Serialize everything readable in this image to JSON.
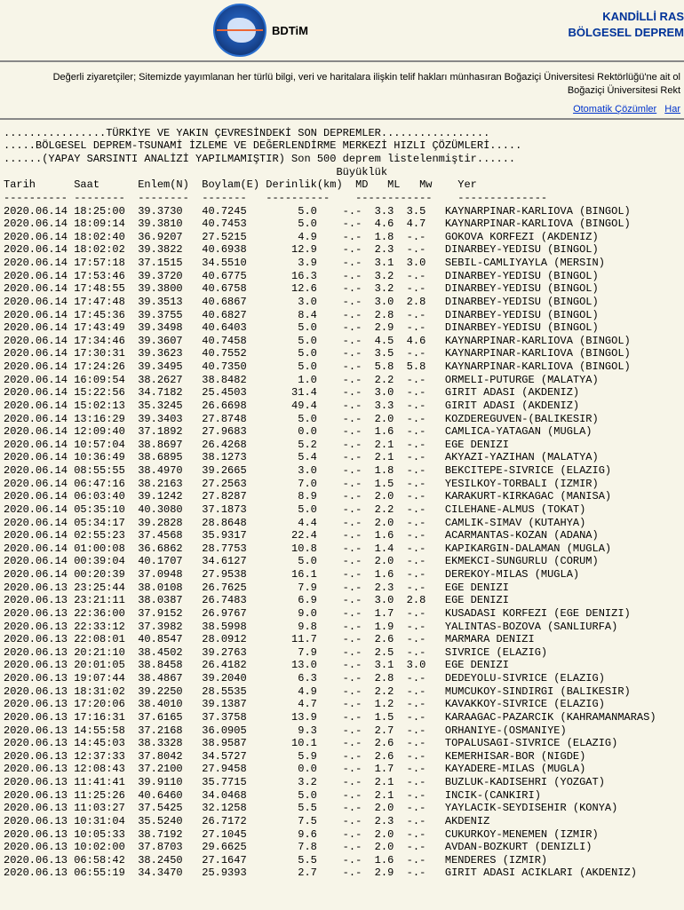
{
  "brand": "BDTiM",
  "title_right_1": "KANDİLLİ RAS",
  "title_right_2": "BÖLGESEL DEPREM",
  "notice_1": "Değerli ziyaretçiler; Sitemizde yayımlanan her türlü bilgi, veri ve haritalara ilişkin telif hakları münhasıran Boğaziçi Üniversitesi Rektörlüğü'ne ait ol",
  "notice_2": "Boğaziçi Üniversitesi Rekt",
  "link_1": "Otomatik Çözümler",
  "link_2": "Har",
  "intro": [
    "................TÜRKİYE VE YAKIN ÇEVRESİNDEKİ SON DEPREMLER.................",
    ".....BÖLGESEL DEPREM-TSUNAMİ İZLEME VE DEĞERLENDİRME MERKEZİ HIZLI ÇÖZÜMLERİ.....",
    "......(YAPAY SARSINTI ANALİZİ YAPILMAMIŞTIR) Son 500 deprem listelenmiştir......"
  ],
  "col_super": "                                                    Büyüklük",
  "col_header": "Tarih      Saat      Enlem(N)  Boylam(E) Derinlik(km)  MD   ML   Mw    Yer",
  "col_sep": "---------- --------  --------  -------   ----------    ------------    --------------",
  "rows": [
    {
      "d": "2020.06.14",
      "t": "18:25:00",
      "lat": "39.3730",
      "lon": "40.7245",
      "dep": "5.0",
      "md": "-.-",
      "ml": "3.3",
      "mw": "3.5",
      "loc": "KAYNARPINAR-KARLIOVA (BINGOL)"
    },
    {
      "d": "2020.06.14",
      "t": "18:09:14",
      "lat": "39.3810",
      "lon": "40.7453",
      "dep": "5.0",
      "md": "-.-",
      "ml": "4.6",
      "mw": "4.7",
      "loc": "KAYNARPINAR-KARLIOVA (BINGOL)"
    },
    {
      "d": "2020.06.14",
      "t": "18:02:40",
      "lat": "36.9207",
      "lon": "27.5215",
      "dep": "4.9",
      "md": "-.-",
      "ml": "1.8",
      "mw": "-.-",
      "loc": "GOKOVA KORFEZI (AKDENIZ)"
    },
    {
      "d": "2020.06.14",
      "t": "18:02:02",
      "lat": "39.3822",
      "lon": "40.6938",
      "dep": "12.9",
      "md": "-.-",
      "ml": "2.3",
      "mw": "-.-",
      "loc": "DINARBEY-YEDISU (BINGOL)"
    },
    {
      "d": "2020.06.14",
      "t": "17:57:18",
      "lat": "37.1515",
      "lon": "34.5510",
      "dep": "3.9",
      "md": "-.-",
      "ml": "3.1",
      "mw": "3.0",
      "loc": "SEBIL-CAMLIYAYLA (MERSIN)"
    },
    {
      "d": "2020.06.14",
      "t": "17:53:46",
      "lat": "39.3720",
      "lon": "40.6775",
      "dep": "16.3",
      "md": "-.-",
      "ml": "3.2",
      "mw": "-.-",
      "loc": "DINARBEY-YEDISU (BINGOL)"
    },
    {
      "d": "2020.06.14",
      "t": "17:48:55",
      "lat": "39.3800",
      "lon": "40.6758",
      "dep": "12.6",
      "md": "-.-",
      "ml": "3.2",
      "mw": "-.-",
      "loc": "DINARBEY-YEDISU (BINGOL)"
    },
    {
      "d": "2020.06.14",
      "t": "17:47:48",
      "lat": "39.3513",
      "lon": "40.6867",
      "dep": "3.0",
      "md": "-.-",
      "ml": "3.0",
      "mw": "2.8",
      "loc": "DINARBEY-YEDISU (BINGOL)"
    },
    {
      "d": "2020.06.14",
      "t": "17:45:36",
      "lat": "39.3755",
      "lon": "40.6827",
      "dep": "8.4",
      "md": "-.-",
      "ml": "2.8",
      "mw": "-.-",
      "loc": "DINARBEY-YEDISU (BINGOL)"
    },
    {
      "d": "2020.06.14",
      "t": "17:43:49",
      "lat": "39.3498",
      "lon": "40.6403",
      "dep": "5.0",
      "md": "-.-",
      "ml": "2.9",
      "mw": "-.-",
      "loc": "DINARBEY-YEDISU (BINGOL)"
    },
    {
      "d": "2020.06.14",
      "t": "17:34:46",
      "lat": "39.3607",
      "lon": "40.7458",
      "dep": "5.0",
      "md": "-.-",
      "ml": "4.5",
      "mw": "4.6",
      "loc": "KAYNARPINAR-KARLIOVA (BINGOL)"
    },
    {
      "d": "2020.06.14",
      "t": "17:30:31",
      "lat": "39.3623",
      "lon": "40.7552",
      "dep": "5.0",
      "md": "-.-",
      "ml": "3.5",
      "mw": "-.-",
      "loc": "KAYNARPINAR-KARLIOVA (BINGOL)"
    },
    {
      "d": "2020.06.14",
      "t": "17:24:26",
      "lat": "39.3495",
      "lon": "40.7350",
      "dep": "5.0",
      "md": "-.-",
      "ml": "5.8",
      "mw": "5.8",
      "loc": "KAYNARPINAR-KARLIOVA (BINGOL)"
    },
    {
      "d": "2020.06.14",
      "t": "16:09:54",
      "lat": "38.2627",
      "lon": "38.8482",
      "dep": "1.0",
      "md": "-.-",
      "ml": "2.2",
      "mw": "-.-",
      "loc": "ORMELI-PUTURGE (MALATYA)"
    },
    {
      "d": "2020.06.14",
      "t": "15:22:56",
      "lat": "34.7182",
      "lon": "25.4503",
      "dep": "31.4",
      "md": "-.-",
      "ml": "3.0",
      "mw": "-.-",
      "loc": "GIRIT ADASI (AKDENIZ)"
    },
    {
      "d": "2020.06.14",
      "t": "15:02:13",
      "lat": "35.3245",
      "lon": "26.6698",
      "dep": "49.4",
      "md": "-.-",
      "ml": "3.3",
      "mw": "-.-",
      "loc": "GIRIT ADASI (AKDENIZ)"
    },
    {
      "d": "2020.06.14",
      "t": "13:16:29",
      "lat": "39.3403",
      "lon": "27.8748",
      "dep": "5.0",
      "md": "-.-",
      "ml": "2.0",
      "mw": "-.-",
      "loc": "KOZDEREGUVEN-(BALIKESIR)"
    },
    {
      "d": "2020.06.14",
      "t": "12:09:40",
      "lat": "37.1892",
      "lon": "27.9683",
      "dep": "0.0",
      "md": "-.-",
      "ml": "1.6",
      "mw": "-.-",
      "loc": "CAMLICA-YATAGAN (MUGLA)"
    },
    {
      "d": "2020.06.14",
      "t": "10:57:04",
      "lat": "38.8697",
      "lon": "26.4268",
      "dep": "5.2",
      "md": "-.-",
      "ml": "2.1",
      "mw": "-.-",
      "loc": "EGE DENIZI"
    },
    {
      "d": "2020.06.14",
      "t": "10:36:49",
      "lat": "38.6895",
      "lon": "38.1273",
      "dep": "5.4",
      "md": "-.-",
      "ml": "2.1",
      "mw": "-.-",
      "loc": "AKYAZI-YAZIHAN (MALATYA)"
    },
    {
      "d": "2020.06.14",
      "t": "08:55:55",
      "lat": "38.4970",
      "lon": "39.2665",
      "dep": "3.0",
      "md": "-.-",
      "ml": "1.8",
      "mw": "-.-",
      "loc": "BEKCITEPE-SIVRICE (ELAZIG)"
    },
    {
      "d": "2020.06.14",
      "t": "06:47:16",
      "lat": "38.2163",
      "lon": "27.2563",
      "dep": "7.0",
      "md": "-.-",
      "ml": "1.5",
      "mw": "-.-",
      "loc": "YESILKOY-TORBALI (IZMIR)"
    },
    {
      "d": "2020.06.14",
      "t": "06:03:40",
      "lat": "39.1242",
      "lon": "27.8287",
      "dep": "8.9",
      "md": "-.-",
      "ml": "2.0",
      "mw": "-.-",
      "loc": "KARAKURT-KIRKAGAC (MANISA)"
    },
    {
      "d": "2020.06.14",
      "t": "05:35:10",
      "lat": "40.3080",
      "lon": "37.1873",
      "dep": "5.0",
      "md": "-.-",
      "ml": "2.2",
      "mw": "-.-",
      "loc": "CILEHANE-ALMUS (TOKAT)"
    },
    {
      "d": "2020.06.14",
      "t": "05:34:17",
      "lat": "39.2828",
      "lon": "28.8648",
      "dep": "4.4",
      "md": "-.-",
      "ml": "2.0",
      "mw": "-.-",
      "loc": "CAMLIK-SIMAV (KUTAHYA)"
    },
    {
      "d": "2020.06.14",
      "t": "02:55:23",
      "lat": "37.4568",
      "lon": "35.9317",
      "dep": "22.4",
      "md": "-.-",
      "ml": "1.6",
      "mw": "-.-",
      "loc": "ACARMANTAS-KOZAN (ADANA)"
    },
    {
      "d": "2020.06.14",
      "t": "01:00:08",
      "lat": "36.6862",
      "lon": "28.7753",
      "dep": "10.8",
      "md": "-.-",
      "ml": "1.4",
      "mw": "-.-",
      "loc": "KAPIKARGIN-DALAMAN (MUGLA)"
    },
    {
      "d": "2020.06.14",
      "t": "00:39:04",
      "lat": "40.1707",
      "lon": "34.6127",
      "dep": "5.0",
      "md": "-.-",
      "ml": "2.0",
      "mw": "-.-",
      "loc": "EKMEKCI-SUNGURLU (CORUM)"
    },
    {
      "d": "2020.06.14",
      "t": "00:20:39",
      "lat": "37.0948",
      "lon": "27.9538",
      "dep": "16.1",
      "md": "-.-",
      "ml": "1.6",
      "mw": "-.-",
      "loc": "DEREKOY-MILAS (MUGLA)"
    },
    {
      "d": "2020.06.13",
      "t": "23:25:44",
      "lat": "38.0108",
      "lon": "26.7625",
      "dep": "7.9",
      "md": "-.-",
      "ml": "2.3",
      "mw": "-.-",
      "loc": "EGE DENIZI"
    },
    {
      "d": "2020.06.13",
      "t": "23:21:11",
      "lat": "38.0387",
      "lon": "26.7483",
      "dep": "6.9",
      "md": "-.-",
      "ml": "3.0",
      "mw": "2.8",
      "loc": "EGE DENIZI"
    },
    {
      "d": "2020.06.13",
      "t": "22:36:00",
      "lat": "37.9152",
      "lon": "26.9767",
      "dep": "9.0",
      "md": "-.-",
      "ml": "1.7",
      "mw": "-.-",
      "loc": "KUSADASI KORFEZI (EGE DENIZI)"
    },
    {
      "d": "2020.06.13",
      "t": "22:33:12",
      "lat": "37.3982",
      "lon": "38.5998",
      "dep": "9.8",
      "md": "-.-",
      "ml": "1.9",
      "mw": "-.-",
      "loc": "YALINTAS-BOZOVA (SANLIURFA)"
    },
    {
      "d": "2020.06.13",
      "t": "22:08:01",
      "lat": "40.8547",
      "lon": "28.0912",
      "dep": "11.7",
      "md": "-.-",
      "ml": "2.6",
      "mw": "-.-",
      "loc": "MARMARA DENIZI"
    },
    {
      "d": "2020.06.13",
      "t": "20:21:10",
      "lat": "38.4502",
      "lon": "39.2763",
      "dep": "7.9",
      "md": "-.-",
      "ml": "2.5",
      "mw": "-.-",
      "loc": "SIVRICE (ELAZIG)"
    },
    {
      "d": "2020.06.13",
      "t": "20:01:05",
      "lat": "38.8458",
      "lon": "26.4182",
      "dep": "13.0",
      "md": "-.-",
      "ml": "3.1",
      "mw": "3.0",
      "loc": "EGE DENIZI"
    },
    {
      "d": "2020.06.13",
      "t": "19:07:44",
      "lat": "38.4867",
      "lon": "39.2040",
      "dep": "6.3",
      "md": "-.-",
      "ml": "2.8",
      "mw": "-.-",
      "loc": "DEDEYOLU-SIVRICE (ELAZIG)"
    },
    {
      "d": "2020.06.13",
      "t": "18:31:02",
      "lat": "39.2250",
      "lon": "28.5535",
      "dep": "4.9",
      "md": "-.-",
      "ml": "2.2",
      "mw": "-.-",
      "loc": "MUMCUKOY-SINDIRGI (BALIKESIR)"
    },
    {
      "d": "2020.06.13",
      "t": "17:20:06",
      "lat": "38.4010",
      "lon": "39.1387",
      "dep": "4.7",
      "md": "-.-",
      "ml": "1.2",
      "mw": "-.-",
      "loc": "KAVAKKOY-SIVRICE (ELAZIG)"
    },
    {
      "d": "2020.06.13",
      "t": "17:16:31",
      "lat": "37.6165",
      "lon": "37.3758",
      "dep": "13.9",
      "md": "-.-",
      "ml": "1.5",
      "mw": "-.-",
      "loc": "KARAAGAC-PAZARCIK (KAHRAMANMARAS)"
    },
    {
      "d": "2020.06.13",
      "t": "14:55:58",
      "lat": "37.2168",
      "lon": "36.0905",
      "dep": "9.3",
      "md": "-.-",
      "ml": "2.7",
      "mw": "-.-",
      "loc": "ORHANIYE-(OSMANIYE)"
    },
    {
      "d": "2020.06.13",
      "t": "14:45:03",
      "lat": "38.3328",
      "lon": "38.9587",
      "dep": "10.1",
      "md": "-.-",
      "ml": "2.6",
      "mw": "-.-",
      "loc": "TOPALUSAGI-SIVRICE (ELAZIG)"
    },
    {
      "d": "2020.06.13",
      "t": "12:37:33",
      "lat": "37.8042",
      "lon": "34.5727",
      "dep": "5.9",
      "md": "-.-",
      "ml": "2.6",
      "mw": "-.-",
      "loc": "KEMERHISAR-BOR (NIGDE)"
    },
    {
      "d": "2020.06.13",
      "t": "12:08:43",
      "lat": "37.2100",
      "lon": "27.9458",
      "dep": "0.0",
      "md": "-.-",
      "ml": "1.7",
      "mw": "-.-",
      "loc": "KAYADERE-MILAS (MUGLA)"
    },
    {
      "d": "2020.06.13",
      "t": "11:41:41",
      "lat": "39.9110",
      "lon": "35.7715",
      "dep": "3.2",
      "md": "-.-",
      "ml": "2.1",
      "mw": "-.-",
      "loc": "BUZLUK-KADISEHRI (YOZGAT)"
    },
    {
      "d": "2020.06.13",
      "t": "11:25:26",
      "lat": "40.6460",
      "lon": "34.0468",
      "dep": "5.0",
      "md": "-.-",
      "ml": "2.1",
      "mw": "-.-",
      "loc": "INCIK-(CANKIRI)"
    },
    {
      "d": "2020.06.13",
      "t": "11:03:27",
      "lat": "37.5425",
      "lon": "32.1258",
      "dep": "5.5",
      "md": "-.-",
      "ml": "2.0",
      "mw": "-.-",
      "loc": "YAYLACIK-SEYDISEHIR (KONYA)"
    },
    {
      "d": "2020.06.13",
      "t": "10:31:04",
      "lat": "35.5240",
      "lon": "26.7172",
      "dep": "7.5",
      "md": "-.-",
      "ml": "2.3",
      "mw": "-.-",
      "loc": "AKDENIZ"
    },
    {
      "d": "2020.06.13",
      "t": "10:05:33",
      "lat": "38.7192",
      "lon": "27.1045",
      "dep": "9.6",
      "md": "-.-",
      "ml": "2.0",
      "mw": "-.-",
      "loc": "CUKURKOY-MENEMEN (IZMIR)"
    },
    {
      "d": "2020.06.13",
      "t": "10:02:00",
      "lat": "37.8703",
      "lon": "29.6625",
      "dep": "7.8",
      "md": "-.-",
      "ml": "2.0",
      "mw": "-.-",
      "loc": "AVDAN-BOZKURT (DENIZLI)"
    },
    {
      "d": "2020.06.13",
      "t": "06:58:42",
      "lat": "38.2450",
      "lon": "27.1647",
      "dep": "5.5",
      "md": "-.-",
      "ml": "1.6",
      "mw": "-.-",
      "loc": "MENDERES (IZMIR)"
    },
    {
      "d": "2020.06.13",
      "t": "06:55:19",
      "lat": "34.3470",
      "lon": "25.9393",
      "dep": "2.7",
      "md": "-.-",
      "ml": "2.9",
      "mw": "-.-",
      "loc": "GIRIT ADASI ACIKLARI (AKDENIZ)"
    }
  ]
}
